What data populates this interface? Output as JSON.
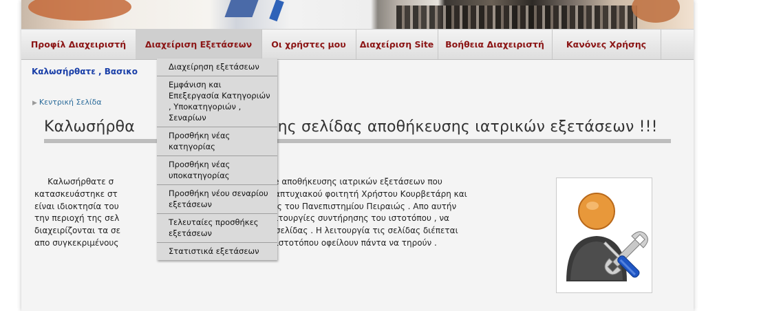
{
  "nav": {
    "items": [
      {
        "label": "Προφίλ Διαχειριστή"
      },
      {
        "label": "Διαχείριση Εξετάσεων"
      },
      {
        "label": "Οι χρήστες μου"
      },
      {
        "label": "Διαχείριση Site"
      },
      {
        "label": "Βοήθεια Διαχειριστή"
      },
      {
        "label": "Κανόνες Χρήσης"
      }
    ]
  },
  "welcome_text": "Καλωσήρθατε , Βασικο",
  "breadcrumb": {
    "label": "Κεντρική Σελίδα"
  },
  "page_title": "Καλωσήρθα                     ιση της σελίδας αποθήκευσης ιατρικών εξετάσεων !!!",
  "content": {
    "lines": [
      "     Καλωσήρθατε σ                                ιστιοσελίδας online αποθήκευσης ιατρικών εξετάσεων που",
      "κατασκευάστηκε στ                                εργασίας του μεταπτυχιακού φοιτητή Χρήστου Κουρβετάρη και",
      "είναι ιδιοκτησία του                               ατος πληροφορικής του Πανεπιστημίου Πειραιώς . Απο αυτήν",
      "την περιοχή της σελ                               ύν να εκτελούν λειτουργίες συντήρησης του ιστοτόπου , να",
      "διαχειρίζονται τα σε                              χρήστες της ιστιοσελίδας . Η λειτουργία τις σελίδας διέπεται",
      "απο συγκεκριμένους                               οι οι χρήστες του ιστοτόπου οφείλουν πάντα να τηρούν ."
    ]
  },
  "colors": {
    "nav_text": "#8b1515",
    "welcome_text": "#1a3fa8",
    "breadcrumb": "#2b6b9a",
    "admin_icon_head": "#e8983a",
    "admin_icon_body": "#3a3a3a"
  },
  "admin_image": {
    "icon": "admin-tools-icon"
  },
  "dropdown": {
    "items": [
      {
        "label": "Διαχείρηση εξετάσεων"
      },
      {
        "label": "Εμφάνιση και Επεξεργασία Κατηγοριών , Υποκατηγοριών , Σεναρίων"
      },
      {
        "label": "Προσθήκη νέας κατηγορίας"
      },
      {
        "label": "Προσθήκη νέας υποκατηγορίας"
      },
      {
        "label": "Προσθήκη νέου σεναρίου εξετάσεων"
      },
      {
        "label": "Τελευταίες προσθήκες εξετάσεων"
      },
      {
        "label": "Στατιστικά εξετάσεων"
      }
    ]
  }
}
